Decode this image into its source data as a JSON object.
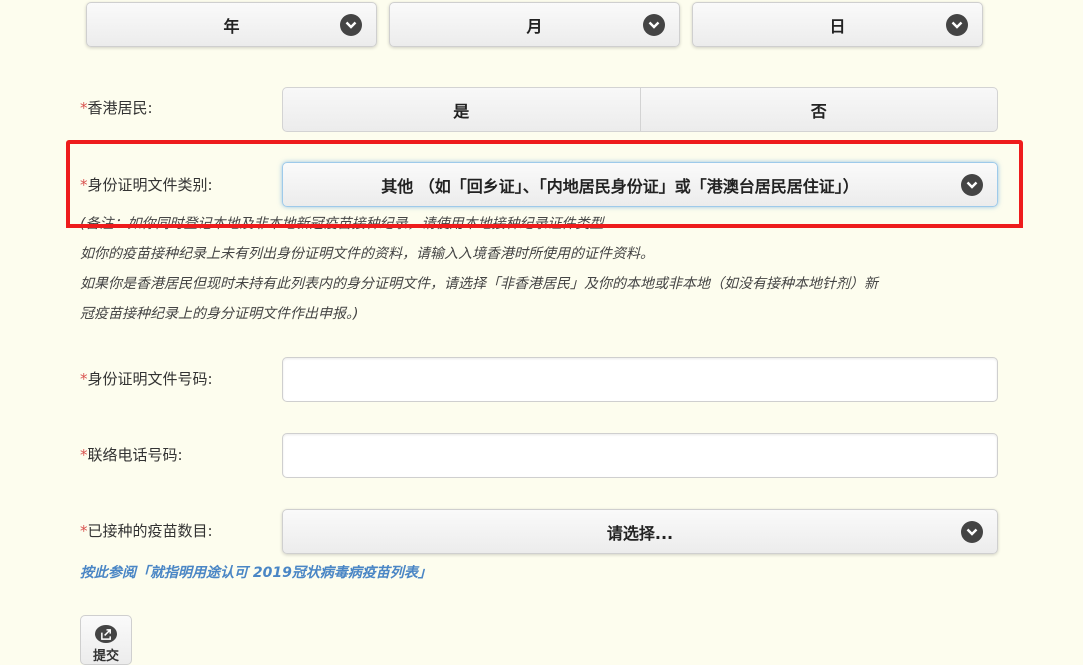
{
  "dob": {
    "year": "年",
    "month": "月",
    "day": "日"
  },
  "hk_resident": {
    "label": "香港居民:",
    "options": [
      "是",
      "否"
    ]
  },
  "id_doc_type": {
    "label": "身份证明文件类别:",
    "value": "其他 （如「回乡证」、「内地居民身份证」或「港澳台居民居住证」）"
  },
  "notes": [
    "(备注：如你同时登记本地及非本地新冠疫苗接种纪录，请使用本地接种纪录证件类型",
    "如你的疫苗接种纪录上未有列出身份证明文件的资料，请输入入境香港时所使用的证件资料。",
    "如果你是香港居民但现时未持有此列表内的身分证明文件，请选择「非香港居民」及你的本地或非本地（如没有接种本地针剂）新",
    "冠疫苗接种纪录上的身分证明文件作出申报。)"
  ],
  "id_number": {
    "label": "身份证明文件号码:",
    "value": ""
  },
  "phone": {
    "label": "联络电话号码:",
    "value": ""
  },
  "vaccine_count": {
    "label": "已接种的疫苗数目:",
    "value": "请选择..."
  },
  "vaccine_list_link": "按此参阅「就指明用途认可 2019冠状病毒病疫苗列表」",
  "submit": {
    "label": "提交",
    "icon": "share-icon"
  },
  "required_mark": "*",
  "colors": {
    "highlight": "#ee1c1c",
    "link": "#4a86c5",
    "background": "#fdfdee"
  }
}
